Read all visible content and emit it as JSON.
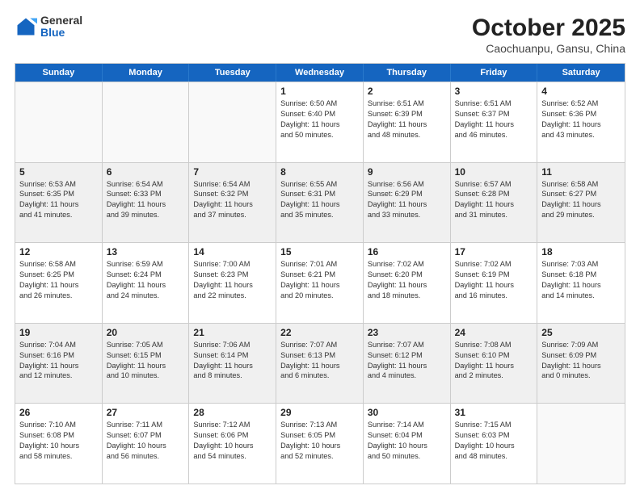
{
  "header": {
    "logo": {
      "line1": "General",
      "line2": "Blue"
    },
    "title": "October 2025",
    "subtitle": "Caochuanpu, Gansu, China"
  },
  "weekdays": [
    "Sunday",
    "Monday",
    "Tuesday",
    "Wednesday",
    "Thursday",
    "Friday",
    "Saturday"
  ],
  "weeks": [
    [
      {
        "day": "",
        "empty": true
      },
      {
        "day": "",
        "empty": true
      },
      {
        "day": "",
        "empty": true
      },
      {
        "day": "1",
        "info": "Sunrise: 6:50 AM\nSunset: 6:40 PM\nDaylight: 11 hours\nand 50 minutes."
      },
      {
        "day": "2",
        "info": "Sunrise: 6:51 AM\nSunset: 6:39 PM\nDaylight: 11 hours\nand 48 minutes."
      },
      {
        "day": "3",
        "info": "Sunrise: 6:51 AM\nSunset: 6:37 PM\nDaylight: 11 hours\nand 46 minutes."
      },
      {
        "day": "4",
        "info": "Sunrise: 6:52 AM\nSunset: 6:36 PM\nDaylight: 11 hours\nand 43 minutes."
      }
    ],
    [
      {
        "day": "5",
        "info": "Sunrise: 6:53 AM\nSunset: 6:35 PM\nDaylight: 11 hours\nand 41 minutes."
      },
      {
        "day": "6",
        "info": "Sunrise: 6:54 AM\nSunset: 6:33 PM\nDaylight: 11 hours\nand 39 minutes."
      },
      {
        "day": "7",
        "info": "Sunrise: 6:54 AM\nSunset: 6:32 PM\nDaylight: 11 hours\nand 37 minutes."
      },
      {
        "day": "8",
        "info": "Sunrise: 6:55 AM\nSunset: 6:31 PM\nDaylight: 11 hours\nand 35 minutes."
      },
      {
        "day": "9",
        "info": "Sunrise: 6:56 AM\nSunset: 6:29 PM\nDaylight: 11 hours\nand 33 minutes."
      },
      {
        "day": "10",
        "info": "Sunrise: 6:57 AM\nSunset: 6:28 PM\nDaylight: 11 hours\nand 31 minutes."
      },
      {
        "day": "11",
        "info": "Sunrise: 6:58 AM\nSunset: 6:27 PM\nDaylight: 11 hours\nand 29 minutes."
      }
    ],
    [
      {
        "day": "12",
        "info": "Sunrise: 6:58 AM\nSunset: 6:25 PM\nDaylight: 11 hours\nand 26 minutes."
      },
      {
        "day": "13",
        "info": "Sunrise: 6:59 AM\nSunset: 6:24 PM\nDaylight: 11 hours\nand 24 minutes."
      },
      {
        "day": "14",
        "info": "Sunrise: 7:00 AM\nSunset: 6:23 PM\nDaylight: 11 hours\nand 22 minutes."
      },
      {
        "day": "15",
        "info": "Sunrise: 7:01 AM\nSunset: 6:21 PM\nDaylight: 11 hours\nand 20 minutes."
      },
      {
        "day": "16",
        "info": "Sunrise: 7:02 AM\nSunset: 6:20 PM\nDaylight: 11 hours\nand 18 minutes."
      },
      {
        "day": "17",
        "info": "Sunrise: 7:02 AM\nSunset: 6:19 PM\nDaylight: 11 hours\nand 16 minutes."
      },
      {
        "day": "18",
        "info": "Sunrise: 7:03 AM\nSunset: 6:18 PM\nDaylight: 11 hours\nand 14 minutes."
      }
    ],
    [
      {
        "day": "19",
        "info": "Sunrise: 7:04 AM\nSunset: 6:16 PM\nDaylight: 11 hours\nand 12 minutes."
      },
      {
        "day": "20",
        "info": "Sunrise: 7:05 AM\nSunset: 6:15 PM\nDaylight: 11 hours\nand 10 minutes."
      },
      {
        "day": "21",
        "info": "Sunrise: 7:06 AM\nSunset: 6:14 PM\nDaylight: 11 hours\nand 8 minutes."
      },
      {
        "day": "22",
        "info": "Sunrise: 7:07 AM\nSunset: 6:13 PM\nDaylight: 11 hours\nand 6 minutes."
      },
      {
        "day": "23",
        "info": "Sunrise: 7:07 AM\nSunset: 6:12 PM\nDaylight: 11 hours\nand 4 minutes."
      },
      {
        "day": "24",
        "info": "Sunrise: 7:08 AM\nSunset: 6:10 PM\nDaylight: 11 hours\nand 2 minutes."
      },
      {
        "day": "25",
        "info": "Sunrise: 7:09 AM\nSunset: 6:09 PM\nDaylight: 11 hours\nand 0 minutes."
      }
    ],
    [
      {
        "day": "26",
        "info": "Sunrise: 7:10 AM\nSunset: 6:08 PM\nDaylight: 10 hours\nand 58 minutes."
      },
      {
        "day": "27",
        "info": "Sunrise: 7:11 AM\nSunset: 6:07 PM\nDaylight: 10 hours\nand 56 minutes."
      },
      {
        "day": "28",
        "info": "Sunrise: 7:12 AM\nSunset: 6:06 PM\nDaylight: 10 hours\nand 54 minutes."
      },
      {
        "day": "29",
        "info": "Sunrise: 7:13 AM\nSunset: 6:05 PM\nDaylight: 10 hours\nand 52 minutes."
      },
      {
        "day": "30",
        "info": "Sunrise: 7:14 AM\nSunset: 6:04 PM\nDaylight: 10 hours\nand 50 minutes."
      },
      {
        "day": "31",
        "info": "Sunrise: 7:15 AM\nSunset: 6:03 PM\nDaylight: 10 hours\nand 48 minutes."
      },
      {
        "day": "",
        "empty": true
      }
    ]
  ]
}
